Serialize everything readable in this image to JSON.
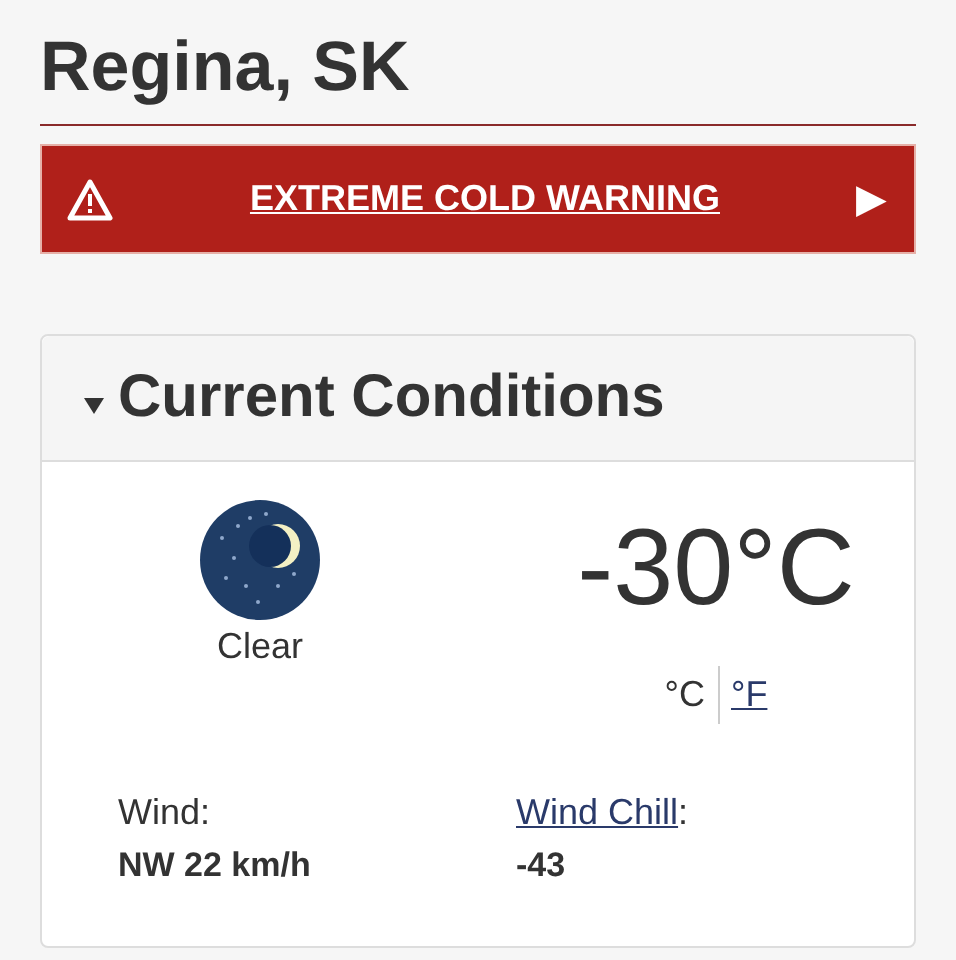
{
  "location": {
    "title": "Regina, SK"
  },
  "alert": {
    "kind": "warning",
    "label": "EXTREME COLD WARNING",
    "arrow": "▶"
  },
  "current_conditions": {
    "title": "Current Conditions",
    "expanded": true,
    "condition": {
      "kind": "clear_night",
      "label": "Clear"
    },
    "temperature": "-30°C",
    "units": [
      {
        "label": "°C",
        "selected": true
      },
      {
        "label": "°F",
        "selected": false
      }
    ],
    "details": [
      {
        "label": "Wind",
        "linked": false,
        "suffix": ":",
        "value": "NW 22 km/h"
      },
      {
        "label": "Wind Chill",
        "linked": true,
        "suffix": ":",
        "value": "-43"
      }
    ]
  }
}
